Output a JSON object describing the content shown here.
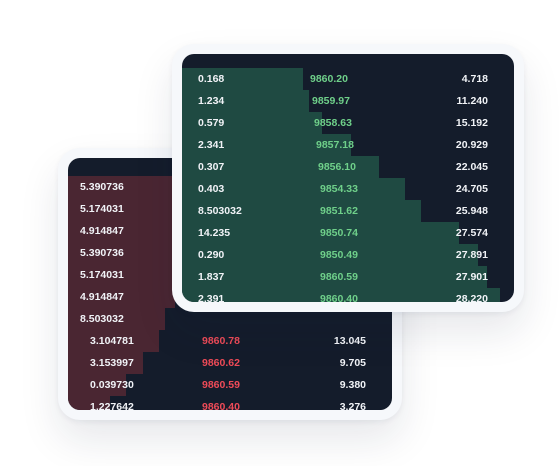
{
  "buy_book": {
    "rows": [
      {
        "amount": "0.168",
        "price": "9860.20",
        "total": "4.718",
        "depth": 0.38
      },
      {
        "amount": "1.234",
        "price": "9859.97",
        "total": "11.240",
        "depth": 0.4
      },
      {
        "amount": "0.579",
        "price": "9858.63",
        "total": "15.192",
        "depth": 0.44
      },
      {
        "amount": "2.341",
        "price": "9857.18",
        "total": "20.929",
        "depth": 0.53
      },
      {
        "amount": "0.307",
        "price": "9856.10",
        "total": "22.045",
        "depth": 0.62
      },
      {
        "amount": "0.403",
        "price": "9854.33",
        "total": "24.705",
        "depth": 0.7
      },
      {
        "amount": "8.503032",
        "price": "9851.62",
        "total": "25.948",
        "depth": 0.75
      },
      {
        "amount": "14.235",
        "price": "9850.74",
        "total": "27.574",
        "depth": 0.87
      },
      {
        "amount": "0.290",
        "price": "9850.49",
        "total": "27.891",
        "depth": 0.93
      },
      {
        "amount": "1.837",
        "price": "9860.59",
        "total": "27.901",
        "depth": 0.96
      },
      {
        "amount": "2.391",
        "price": "9860.40",
        "total": "28.220",
        "depth": 1.0
      }
    ]
  },
  "sell_book": {
    "hidden_rows": [
      {
        "amount": "5.390736",
        "depth": 0.33
      },
      {
        "amount": "5.174031",
        "depth": 0.33
      },
      {
        "amount": "4.914847",
        "depth": 0.33
      },
      {
        "amount": "5.390736",
        "depth": 0.33
      },
      {
        "amount": "5.174031",
        "depth": 0.33
      },
      {
        "amount": "4.914847",
        "depth": 0.33
      },
      {
        "amount": "8.503032",
        "depth": 0.3
      }
    ],
    "rows": [
      {
        "amount": "3.104781",
        "price": "9860.78",
        "total": "13.045",
        "depth": 0.28
      },
      {
        "amount": "3.153997",
        "price": "9860.62",
        "total": "9.705",
        "depth": 0.23
      },
      {
        "amount": "0.039730",
        "price": "9860.59",
        "total": "9.380",
        "depth": 0.18
      },
      {
        "amount": "1.227642",
        "price": "9860.40",
        "total": "3.276",
        "depth": 0.13
      }
    ]
  },
  "colors": {
    "screen_bg": "#141c2b",
    "buy_depth": "#1f4a42",
    "sell_depth": "#4a2632",
    "price_green": "#6fd08a",
    "price_red": "#ef4b58",
    "text_light": "#f1f3f7"
  }
}
